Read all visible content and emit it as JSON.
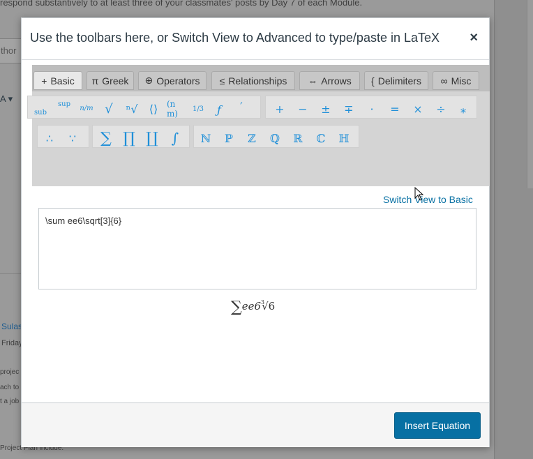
{
  "background": {
    "top_text": "respond substantively to at least three of your classmates' posts by Day 7 of each Module.",
    "author_placeholder": "thor",
    "user_name": "Sulas",
    "date_text": "Friday",
    "body_lines": [
      "projec",
      "ach to",
      "t a job"
    ],
    "bottom_text": "Project Plan include:"
  },
  "modal": {
    "title": "Use the toolbars here, or Switch View to Advanced to type/paste in LaTeX",
    "close_label": "×",
    "tabs": [
      {
        "icon": "+",
        "label": "Basic"
      },
      {
        "icon": "π",
        "label": "Greek"
      },
      {
        "icon": "⊕",
        "label": "Operators"
      },
      {
        "icon": "≤",
        "label": "Relationships"
      },
      {
        "icon": "⇔",
        "label": "Arrows"
      },
      {
        "icon": "{",
        "label": "Delimiters"
      },
      {
        "icon": "∞",
        "label": "Misc"
      }
    ],
    "symbols": {
      "row1_group1": [
        "sub",
        "sup",
        "n/m",
        "√",
        "ⁿ√",
        "⟨⟩",
        "(n m)",
        "1/3",
        "ƒ",
        "′"
      ],
      "row1_group2": [
        "+",
        "−",
        "±",
        "∓",
        "·",
        "=",
        "×",
        "÷",
        "∗"
      ],
      "row2_group1": [
        "∴",
        "∵"
      ],
      "row2_group2": [
        "∑",
        "∏",
        "∐",
        "∫"
      ],
      "row2_group3": [
        "ℕ",
        "ℙ",
        "ℤ",
        "ℚ",
        "ℝ",
        "ℂ",
        "ℍ"
      ]
    },
    "switch_link": "Switch View to Basic",
    "latex_value": "\\sum ee6\\sqrt[3]{6}",
    "preview": {
      "sum": "∑",
      "body": "ee6",
      "root_index": "3",
      "root": "√6"
    },
    "insert_button": "Insert Equation"
  }
}
